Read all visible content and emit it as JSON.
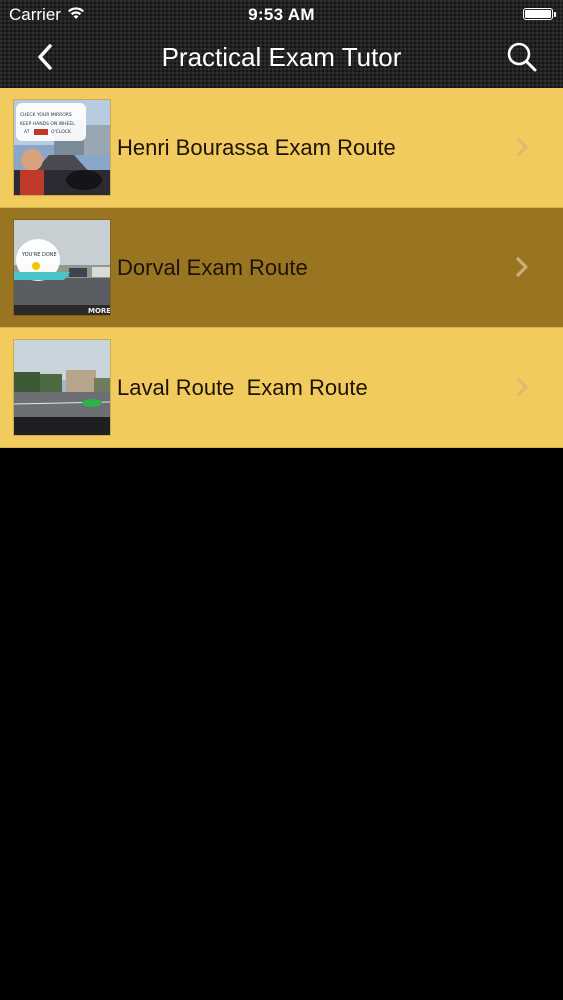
{
  "status_bar": {
    "carrier": "Carrier",
    "time": "9:53 AM"
  },
  "nav": {
    "title": "Practical Exam Tutor",
    "back_icon": "chevron-left-icon",
    "search_icon": "search-icon"
  },
  "routes": [
    {
      "label": "Henri Bourassa Exam Route",
      "selected": false,
      "thumbnail_text": [
        "CHECK YOUR MIRRORS",
        "KEEP HANDS ON WHEEL",
        "AT",
        "O'CLOCK"
      ]
    },
    {
      "label": "Dorval Exam Route",
      "selected": true,
      "thumbnail_text": [
        "YOU'RE DONE",
        "MORE"
      ]
    },
    {
      "label": "Laval Route  Exam Route",
      "selected": false,
      "thumbnail_text": []
    }
  ],
  "colors": {
    "row_normal": "#f1cb5d",
    "row_selected": "#9a7521",
    "header": "#222222"
  }
}
